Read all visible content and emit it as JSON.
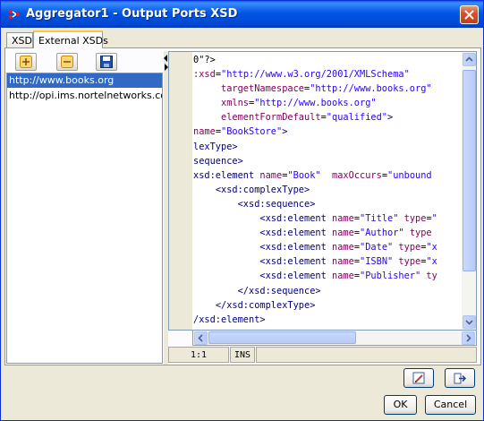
{
  "window": {
    "title": "Aggregator1 - Output Ports XSD",
    "close_icon": "close-icon"
  },
  "tabs": [
    {
      "label": "XSD",
      "active": false
    },
    {
      "label": "External XSDs",
      "active": true
    }
  ],
  "toolbar": {
    "add_icon": "add-icon",
    "remove_icon": "remove-icon",
    "save_icon": "save-icon"
  },
  "url_list": [
    {
      "url": "http://www.books.org",
      "selected": true
    },
    {
      "url": "http://opi.ims.nortelnetworks.com",
      "selected": false
    }
  ],
  "editor": {
    "lines": [
      {
        "n": "1",
        "parts": [
          [
            "p",
            "0\"?>"
          ]
        ]
      },
      {
        "n": "2",
        "parts": [
          [
            "a",
            ":xsd"
          ],
          [
            "p",
            "="
          ],
          [
            "v",
            "\"http://www.w3.org/2001/XMLSchema\""
          ]
        ]
      },
      {
        "n": "3",
        "parts": [
          [
            "p",
            "     "
          ],
          [
            "a",
            "targetNamespace"
          ],
          [
            "p",
            "="
          ],
          [
            "v",
            "\"http://www.books.org\""
          ]
        ]
      },
      {
        "n": "4",
        "parts": [
          [
            "p",
            "     "
          ],
          [
            "a",
            "xmlns"
          ],
          [
            "p",
            "="
          ],
          [
            "v",
            "\"http://www.books.org\""
          ]
        ]
      },
      {
        "n": "5",
        "parts": [
          [
            "p",
            "     "
          ],
          [
            "a",
            "elementFormDefault"
          ],
          [
            "p",
            "="
          ],
          [
            "v",
            "\"qualified\""
          ],
          [
            "t",
            ">"
          ]
        ]
      },
      {
        "n": "6",
        "parts": [
          [
            "a",
            "name"
          ],
          [
            "p",
            "="
          ],
          [
            "v",
            "\"BookStore\""
          ],
          [
            "t",
            ">"
          ]
        ]
      },
      {
        "n": "7",
        "parts": [
          [
            "t",
            "lexType>"
          ]
        ]
      },
      {
        "n": "8",
        "parts": [
          [
            "t",
            "sequence>"
          ]
        ]
      },
      {
        "n": "9",
        "parts": [
          [
            "t",
            "xsd:element "
          ],
          [
            "a",
            "name"
          ],
          [
            "p",
            "="
          ],
          [
            "v",
            "\"Book\""
          ],
          [
            "p",
            "  "
          ],
          [
            "a",
            "maxOccurs"
          ],
          [
            "p",
            "="
          ],
          [
            "v",
            "\"unbound"
          ]
        ]
      },
      {
        "n": "10",
        "parts": [
          [
            "p",
            "    "
          ],
          [
            "t",
            "<xsd:complexType>"
          ]
        ]
      },
      {
        "n": "11",
        "parts": [
          [
            "p",
            "        "
          ],
          [
            "t",
            "<xsd:sequence>"
          ]
        ]
      },
      {
        "n": "12",
        "parts": [
          [
            "p",
            "            "
          ],
          [
            "t",
            "<xsd:element "
          ],
          [
            "a",
            "name"
          ],
          [
            "p",
            "="
          ],
          [
            "v",
            "\"Title\""
          ],
          [
            "p",
            " "
          ],
          [
            "a",
            "type"
          ],
          [
            "p",
            "="
          ],
          [
            "v",
            "\""
          ]
        ]
      },
      {
        "n": "13",
        "parts": [
          [
            "p",
            "            "
          ],
          [
            "t",
            "<xsd:element "
          ],
          [
            "a",
            "name"
          ],
          [
            "p",
            "="
          ],
          [
            "v",
            "\"Author\""
          ],
          [
            "p",
            " "
          ],
          [
            "a",
            "type"
          ]
        ]
      },
      {
        "n": "14",
        "parts": [
          [
            "p",
            "            "
          ],
          [
            "t",
            "<xsd:element "
          ],
          [
            "a",
            "name"
          ],
          [
            "p",
            "="
          ],
          [
            "v",
            "\"Date\""
          ],
          [
            "p",
            " "
          ],
          [
            "a",
            "type"
          ],
          [
            "p",
            "="
          ],
          [
            "v",
            "\"x"
          ]
        ]
      },
      {
        "n": "15",
        "parts": [
          [
            "p",
            "            "
          ],
          [
            "t",
            "<xsd:element "
          ],
          [
            "a",
            "name"
          ],
          [
            "p",
            "="
          ],
          [
            "v",
            "\"ISBN\""
          ],
          [
            "p",
            " "
          ],
          [
            "a",
            "type"
          ],
          [
            "p",
            "="
          ],
          [
            "v",
            "\"x"
          ]
        ]
      },
      {
        "n": "16",
        "parts": [
          [
            "p",
            "            "
          ],
          [
            "t",
            "<xsd:element "
          ],
          [
            "a",
            "name"
          ],
          [
            "p",
            "="
          ],
          [
            "v",
            "\"Publisher\""
          ],
          [
            "p",
            " "
          ],
          [
            "a",
            "ty"
          ]
        ]
      },
      {
        "n": "17",
        "parts": [
          [
            "p",
            "        "
          ],
          [
            "t",
            "</xsd:sequence>"
          ]
        ]
      },
      {
        "n": "18",
        "parts": [
          [
            "p",
            "    "
          ],
          [
            "t",
            "</xsd:complexType>"
          ]
        ]
      },
      {
        "n": "19",
        "parts": [
          [
            "t",
            "/xsd:element>"
          ]
        ]
      }
    ]
  },
  "status": {
    "position": "1:1",
    "mode": "INS"
  },
  "bottom_icons": {
    "left": "edit-icon",
    "right": "export-icon"
  },
  "buttons": {
    "ok": "OK",
    "cancel": "Cancel"
  }
}
